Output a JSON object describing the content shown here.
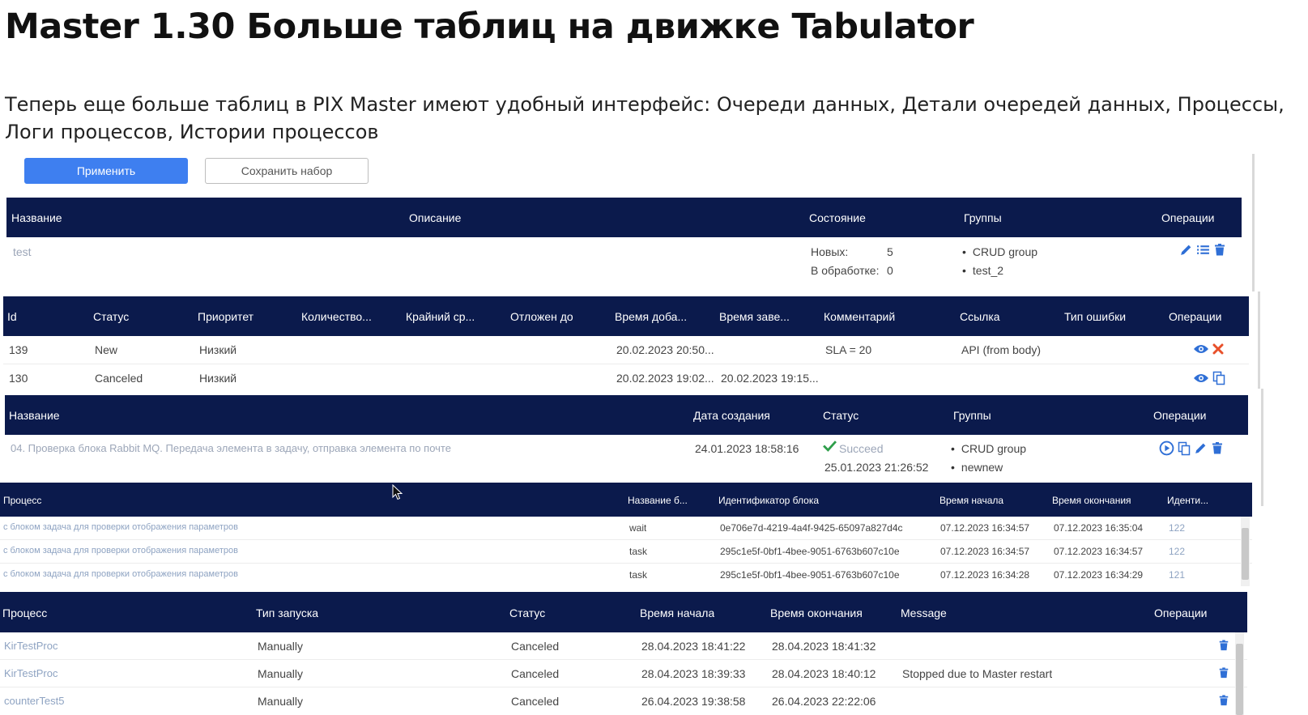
{
  "slide": {
    "title": "Master 1.30 Больше таблиц на движке Tabulator",
    "subtitle_line1": "Теперь еще больше таблиц в PIX Master имеют удобный интерфейс: Очереди данных, Детали очередей данных, Процессы,",
    "subtitle_line2": "Логи процессов, Истории процессов"
  },
  "buttons": {
    "apply": "Применить",
    "save_set": "Сохранить набор"
  },
  "queues_table": {
    "headers": [
      "Название",
      "Описание",
      "Состояние",
      "Группы",
      "Операции"
    ],
    "row": {
      "name": "test",
      "state_new_label": "Новых:",
      "state_new_value": "5",
      "state_processing_label": "В обработке:",
      "state_processing_value": "0",
      "groups": [
        "CRUD group",
        "test_2"
      ]
    }
  },
  "queue_details_table": {
    "headers": [
      "Id",
      "Статус",
      "Приоритет",
      "Количество...",
      "Крайний ср...",
      "Отложен до",
      "Время доба...",
      "Время заве...",
      "Комментарий",
      "Ссылка",
      "Тип ошибки",
      "Операции"
    ],
    "rows": [
      {
        "id": "139",
        "status": "New",
        "priority": "Низкий",
        "added": "20.02.2023 20:50...",
        "finished": "",
        "comment": "SLA = 20",
        "link": "API (from body)"
      },
      {
        "id": "130",
        "status": "Canceled",
        "priority": "Низкий",
        "added": "20.02.2023 19:02...",
        "finished": "20.02.2023 19:15...",
        "comment": "",
        "link": ""
      }
    ]
  },
  "processes_table": {
    "headers": [
      "Название",
      "Дата создания",
      "Статус",
      "Группы",
      "Операции"
    ],
    "row": {
      "name": "04. Проверка блока Rabbit MQ. Передача элемента в задачу, отправка элемента по почте",
      "created": "24.01.2023 18:58:16",
      "status": "Succeed",
      "status_time": "25.01.2023 21:26:52",
      "groups": [
        "CRUD group",
        "newnew"
      ]
    }
  },
  "process_logs_table": {
    "headers": [
      "Процесс",
      "Название б...",
      "Идентификатор блока",
      "Время начала",
      "Время окончания",
      "Иденти..."
    ],
    "rows": [
      {
        "process": "с блоком задача для проверки отображения параметров",
        "block": "wait",
        "block_id": "0e706e7d-4219-4a4f-9425-65097a827d4c",
        "start": "07.12.2023 16:34:57",
        "end": "07.12.2023 16:35:04",
        "ident": "122"
      },
      {
        "process": "с блоком задача для проверки отображения параметров",
        "block": "task",
        "block_id": "295c1e5f-0bf1-4bee-9051-6763b607c10e",
        "start": "07.12.2023 16:34:57",
        "end": "07.12.2023 16:34:57",
        "ident": "122"
      },
      {
        "process": "с блоком задача для проверки отображения параметров",
        "block": "task",
        "block_id": "295c1e5f-0bf1-4bee-9051-6763b607c10e",
        "start": "07.12.2023 16:34:28",
        "end": "07.12.2023 16:34:29",
        "ident": "121"
      }
    ]
  },
  "process_history_table": {
    "headers": [
      "Процесс",
      "Тип запуска",
      "Статус",
      "Время начала",
      "Время окончания",
      "Message",
      "Операции"
    ],
    "rows": [
      {
        "process": "KirTestProc",
        "launch": "Manually",
        "status": "Canceled",
        "start": "28.04.2023 18:41:22",
        "end": "28.04.2023 18:41:32",
        "message": ""
      },
      {
        "process": "KirTestProc",
        "launch": "Manually",
        "status": "Canceled",
        "start": "28.04.2023 18:39:33",
        "end": "28.04.2023 18:40:12",
        "message": "Stopped due to Master restart"
      },
      {
        "process": "counterTest5",
        "launch": "Manually",
        "status": "Canceled",
        "start": "26.04.2023 19:38:58",
        "end": "26.04.2023 22:22:06",
        "message": ""
      }
    ]
  },
  "colors": {
    "header_bg": "#0b1a4c",
    "primary": "#3e7ff0",
    "icon": "#2f6fd6",
    "delete_x": "#e8502a",
    "success": "#2e9e4a"
  }
}
